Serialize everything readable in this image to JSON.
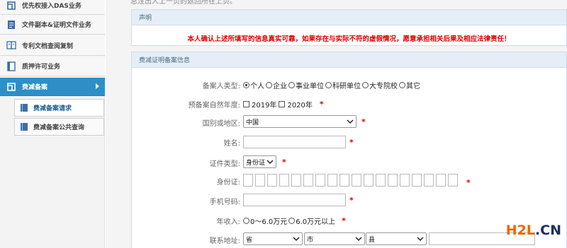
{
  "sidebar": {
    "items": [
      {
        "label": "优先权接入DAS业务",
        "icon": "priority-icon"
      },
      {
        "label": "文件副本&证明文件业务",
        "icon": "document-copy-icon"
      },
      {
        "label": "专利文档查阅复制",
        "icon": "patent-doc-icon"
      },
      {
        "label": "质押许可业务",
        "icon": "pledge-icon"
      },
      {
        "label": "费减备案",
        "icon": "fee-reduction-icon"
      }
    ],
    "subitems": [
      {
        "label": "费减备案请求",
        "icon": "book-icon"
      },
      {
        "label": "费减备案公共查询",
        "icon": "book-icon"
      }
    ]
  },
  "main": {
    "top_text": "总注出人上一页的返回所在上页。",
    "statement_panel": {
      "title": "声明",
      "text": "本人确认上述所填写的信息真实可靠，如果存在与实际不符的虚假情况，愿意承担相关后果及相应法律责任！"
    },
    "form_panel": {
      "title": "费减证明备案信息",
      "required_mark": "*",
      "filer_type": {
        "label": "备案人类型:",
        "options": [
          "个人",
          "企业",
          "事业单位",
          "科研单位",
          "大专院校",
          "其它"
        ],
        "selected": "个人"
      },
      "year": {
        "label": "预备案自然年度:",
        "options": [
          "2019年",
          "2020年"
        ]
      },
      "country": {
        "label": "国别或地区:",
        "value": "中国"
      },
      "name": {
        "label": "姓名:",
        "value": ""
      },
      "id_type": {
        "label": "证件类型:",
        "value": "身份证"
      },
      "id_number": {
        "label": "身份证:"
      },
      "phone": {
        "label": "手机号码:",
        "value": ""
      },
      "income": {
        "label": "年收入:",
        "options": [
          "0～6.0万元",
          "6.0万元以上"
        ]
      },
      "address": {
        "label": "联系地址:",
        "province": "省",
        "city": "市",
        "county": "县"
      }
    }
  },
  "watermark": {
    "left": "H2L",
    "dot": ".",
    "right": "CN"
  },
  "colors": {
    "accent": "#2e8fc6",
    "required": "#e00000",
    "panel_head": "#e5eef6",
    "watermark": "#e66a00"
  }
}
